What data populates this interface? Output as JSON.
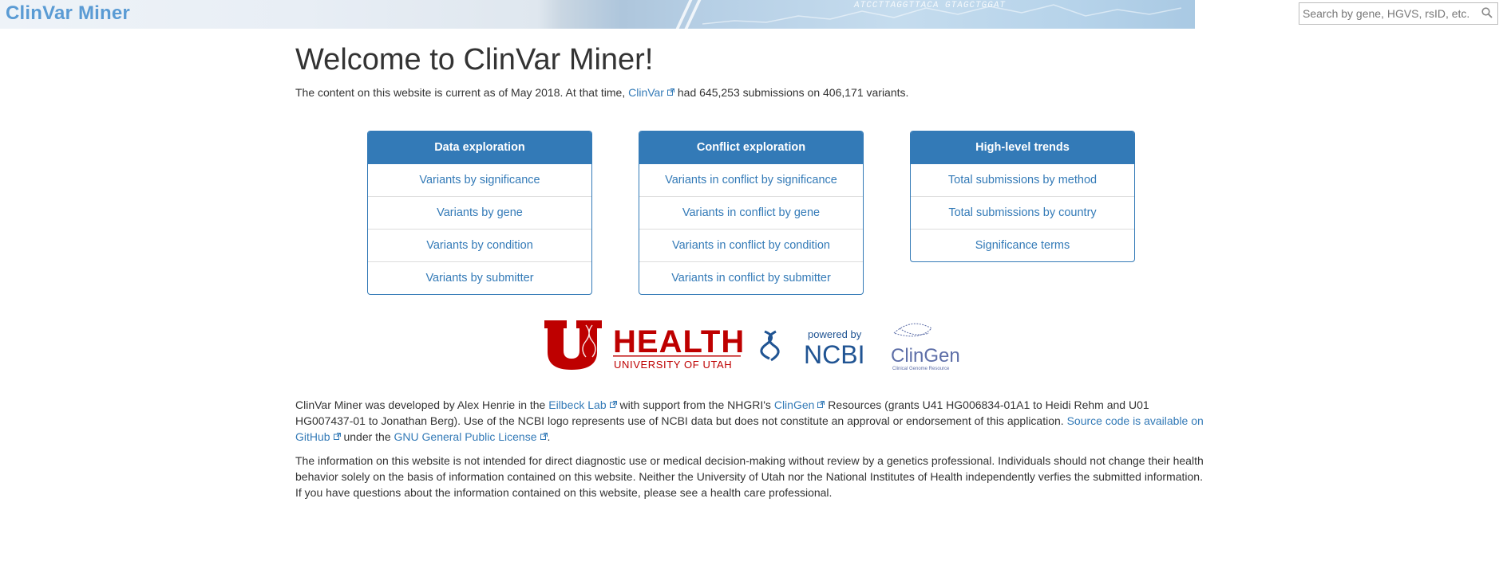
{
  "header": {
    "brand": "ClinVar Miner",
    "banner_sequence": "ATCCTTAGGTTACA GTAGCTGGAT",
    "search_placeholder": "Search by gene, HGVS, rsID, etc.",
    "search_icon": "search-icon"
  },
  "main": {
    "title": "Welcome to ClinVar Miner!",
    "intro_before": "The content on this website is current as of May 2018. At that time, ",
    "intro_link": "ClinVar",
    "intro_after": " had 645,253 submissions on 406,171 variants."
  },
  "panels": [
    {
      "title": "Data exploration",
      "items": [
        "Variants by significance",
        "Variants by gene",
        "Variants by condition",
        "Variants by submitter"
      ]
    },
    {
      "title": "Conflict exploration",
      "items": [
        "Variants in conflict by significance",
        "Variants in conflict by gene",
        "Variants in conflict by condition",
        "Variants in conflict by submitter"
      ]
    },
    {
      "title": "High-level trends",
      "items": [
        "Total submissions by method",
        "Total submissions by country",
        "Significance terms"
      ]
    }
  ],
  "logos": {
    "uofu_health": "HEALTH",
    "uofu_sub": "UNIVERSITY OF UTAH",
    "ncbi_powered": "powered by",
    "ncbi": "NCBI",
    "clingen": "ClinGen",
    "clingen_sub": "Clinical Genome Resource"
  },
  "footer": {
    "p1_a": "ClinVar Miner was developed by Alex Henrie in the ",
    "p1_link1": "Eilbeck Lab",
    "p1_b": " with support from the NHGRI's ",
    "p1_link2": "ClinGen",
    "p1_c": " Resources (grants U41 HG006834-01A1 to Heidi Rehm and U01 HG007437-01 to Jonathan Berg). Use of the NCBI logo represents use of NCBI data but does not constitute an approval or endorsement of this application. ",
    "p1_link3": "Source code is available on GitHub",
    "p1_d": " under the ",
    "p1_link4": "GNU General Public License",
    "p1_e": ".",
    "p2": "The information on this website is not intended for direct diagnostic use or medical decision-making without review by a genetics professional. Individuals should not change their health behavior solely on the basis of information contained on this website. Neither the University of Utah nor the National Institutes of Health independently verfies the submitted information. If you have questions about the information contained on this website, please see a health care professional."
  },
  "colors": {
    "brand_blue": "#5a9bd4",
    "panel_blue": "#337ab7",
    "utah_red": "#be0000",
    "ncbi_blue": "#205493"
  }
}
